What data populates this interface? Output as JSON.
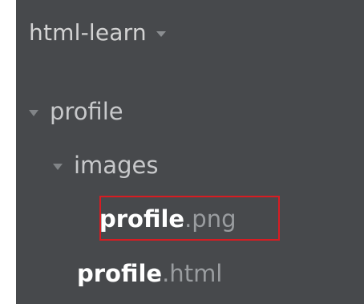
{
  "project": {
    "name": "html-learn",
    "caret_icon": "caret-down-icon"
  },
  "tree": {
    "folder_profile": {
      "label": "profile",
      "twist_icon": "caret-down-icon"
    },
    "folder_images": {
      "label": "images",
      "twist_icon": "caret-down-icon"
    },
    "file_png": {
      "name": "profile",
      "ext": ".png"
    },
    "file_html": {
      "name": "profile",
      "ext": ".html"
    }
  },
  "colors": {
    "panel_bg": "#47494c",
    "highlight_border": "#d81c22",
    "file_name": "#ffffff",
    "file_ext": "#9a9da0"
  }
}
